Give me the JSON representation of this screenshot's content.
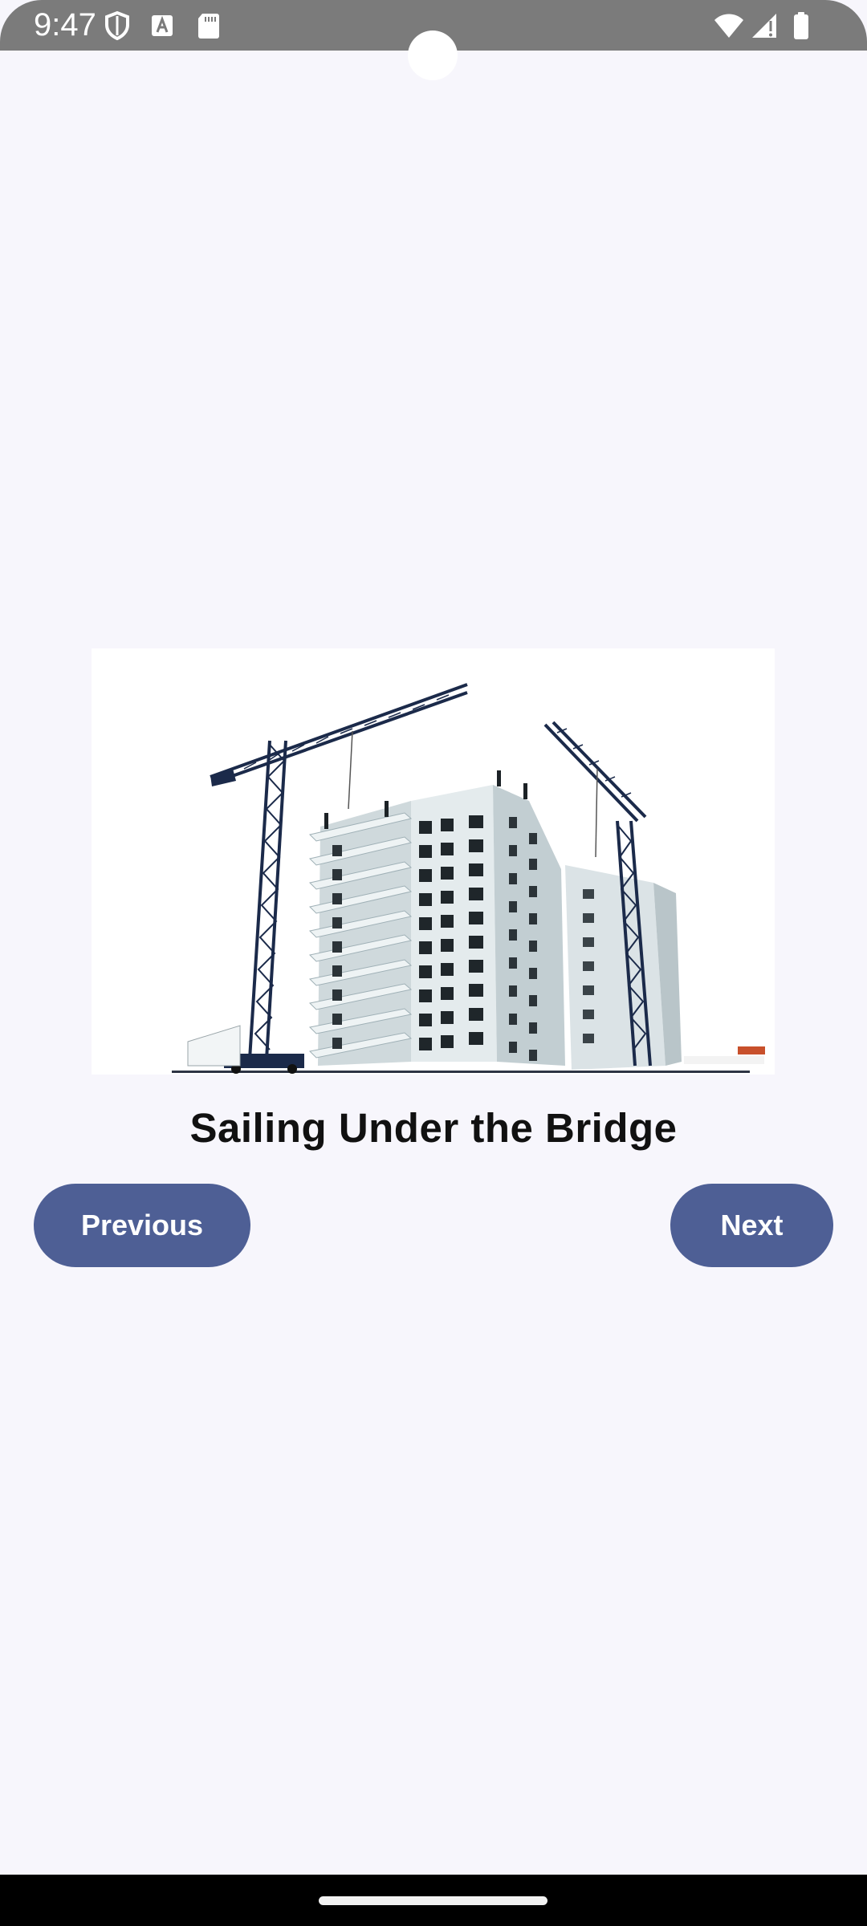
{
  "status_bar": {
    "time": "9:47",
    "icons_left": [
      "shield-icon",
      "font-a-icon",
      "sd-card-icon"
    ],
    "icons_right": [
      "wifi-icon",
      "signal-icon",
      "battery-icon"
    ],
    "background": "#7b7b7b"
  },
  "content": {
    "image_description_icon": "construction-building-image",
    "title": "Sailing Under the Bridge"
  },
  "buttons": {
    "previous_label": "Previous",
    "next_label": "Next",
    "color": "#4e5f95"
  },
  "colors": {
    "background": "#f7f6fc",
    "accent": "#4e5f95"
  }
}
